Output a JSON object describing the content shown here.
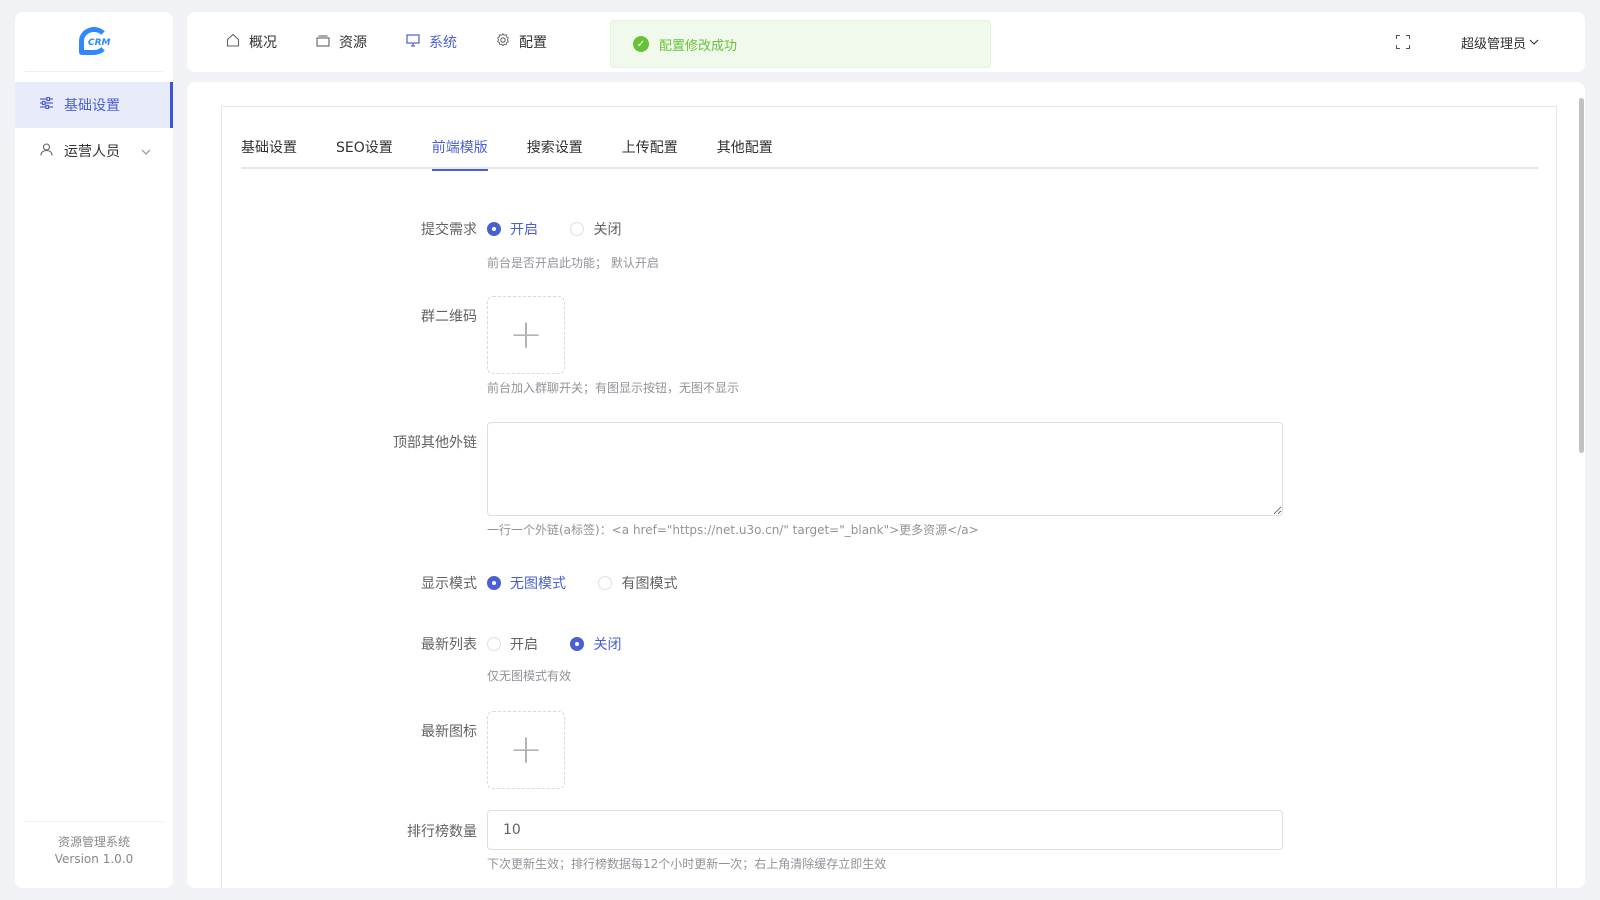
{
  "sidebar": {
    "logo_text": "CRM",
    "items": [
      {
        "label": "基础设置",
        "icon": "sliders-icon"
      },
      {
        "label": "运营人员",
        "icon": "user-icon"
      }
    ],
    "footer_name": "资源管理系统",
    "footer_version": "Version 1.0.0"
  },
  "topnav": {
    "items": [
      {
        "label": "概况",
        "icon": "home-icon"
      },
      {
        "label": "资源",
        "icon": "folder-icon"
      },
      {
        "label": "系统",
        "icon": "monitor-icon"
      },
      {
        "label": "配置",
        "icon": "gear-icon"
      }
    ],
    "active_index": 2,
    "user_name": "超级管理员"
  },
  "toast": {
    "message": "配置修改成功",
    "type": "success"
  },
  "tabs": [
    {
      "label": "基础设置"
    },
    {
      "label": "SEO设置"
    },
    {
      "label": "前端模版"
    },
    {
      "label": "搜索设置"
    },
    {
      "label": "上传配置"
    },
    {
      "label": "其他配置"
    }
  ],
  "active_tab": 2,
  "form": {
    "submit_demand": {
      "label": "提交需求",
      "options": [
        "开启",
        "关闭"
      ],
      "selected": "开启",
      "help": "前台是否开启此功能； 默认开启"
    },
    "group_qrcode": {
      "label": "群二维码",
      "help": "前台加入群聊开关；有图显示按钮，无图不显示"
    },
    "top_links": {
      "label": "顶部其他外链",
      "value": "",
      "help": "一行一个外链(a标签)：<a href=\"https://net.u3o.cn/\" target=\"_blank\">更多资源</a>"
    },
    "display_mode": {
      "label": "显示模式",
      "options": [
        "无图模式",
        "有图模式"
      ],
      "selected": "无图模式"
    },
    "latest_list": {
      "label": "最新列表",
      "options": [
        "开启",
        "关闭"
      ],
      "selected": "关闭",
      "help": "仅无图模式有效"
    },
    "latest_icon": {
      "label": "最新图标"
    },
    "rank_count": {
      "label": "排行榜数量",
      "value": "10",
      "help": "下次更新生效；排行榜数据每12个小时更新一次；右上角清除缓存立即生效"
    }
  },
  "colors": {
    "primary": "#4a5fd1",
    "success": "#67c23a",
    "background": "#f0f2f5"
  }
}
